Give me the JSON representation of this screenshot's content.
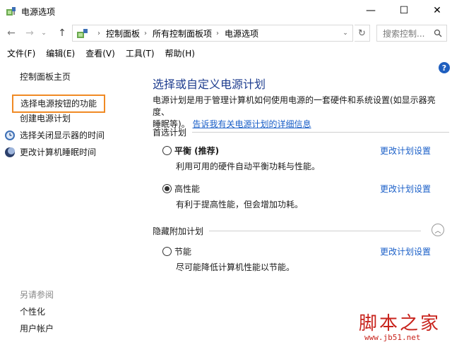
{
  "window": {
    "title": "电源选项",
    "minimize_symbol": "—",
    "maximize_symbol": "☐",
    "close_symbol": "✕"
  },
  "nav": {
    "back_symbol": "←",
    "forward_symbol": "→",
    "recent_symbol": "⌄",
    "up_symbol": "↑",
    "breadcrumbs": [
      "控制面板",
      "所有控制面板项",
      "电源选项"
    ],
    "breadcrumb_sep": "›",
    "refresh_symbol": "↻",
    "search_placeholder": "搜索控制..."
  },
  "menu": {
    "items": [
      "文件(F)",
      "编辑(E)",
      "查看(V)",
      "工具(T)",
      "帮助(H)"
    ]
  },
  "sidebar": {
    "home": "控制面板主页",
    "power_buttons": "选择电源按钮的功能",
    "create_plan": "创建电源计划",
    "display_off": "选择关闭显示器的时间",
    "sleep_time": "更改计算机睡眠时间",
    "see_also": "另请参阅",
    "personalization": "个性化",
    "user_accounts": "用户帐户"
  },
  "help_symbol": "?",
  "main": {
    "title": "选择或自定义电源计划",
    "description_line1": "电源计划是用于管理计算机如何使用电源的一套硬件和系统设置(如显示器亮度、",
    "description_line2_prefix": "睡眠等)。",
    "description_link": "告诉我有关电源计划的详细信息",
    "preferred_heading": "首选计划",
    "hidden_heading": "隐藏附加计划",
    "collapse_symbol": "︿",
    "plans": [
      {
        "name": "平衡 (推荐)",
        "description": "利用可用的硬件自动平衡功耗与性能。",
        "change_link": "更改计划设置",
        "selected": false
      },
      {
        "name": "高性能",
        "description": "有利于提高性能，但会增加功耗。",
        "change_link": "更改计划设置",
        "selected": true
      },
      {
        "name": "节能",
        "description": "尽可能降低计算机性能以节能。",
        "change_link": "更改计划设置",
        "selected": false
      }
    ]
  },
  "watermark": {
    "logo_text": "脚本之家",
    "url": "www.jb51.net"
  },
  "colors": {
    "accent_link": "#1a5fc8",
    "title_blue": "#1e3d8f",
    "highlight_orange": "#f08a24",
    "watermark_red": "#c8231c"
  }
}
